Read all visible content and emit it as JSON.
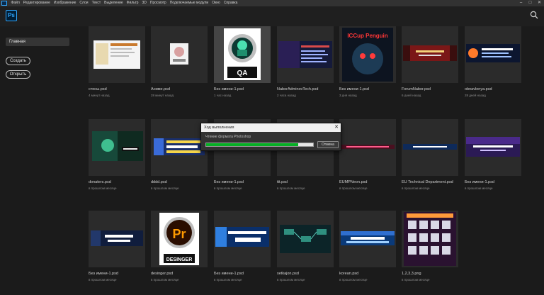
{
  "menubar": {
    "items": [
      "Файл",
      "Редактирование",
      "Изображение",
      "Слои",
      "Текст",
      "Выделение",
      "Фильтр",
      "3D",
      "Просмотр",
      "Подключаемые модули",
      "Окно",
      "Справка"
    ]
  },
  "header": {
    "logo_text": "Ps"
  },
  "sidebar": {
    "home_label": "Главная",
    "create_label": "Создать",
    "open_label": "Открыть"
  },
  "files": [
    {
      "name": "стены.psd",
      "date": "4 минут назад"
    },
    {
      "name": "Аниме.psd",
      "date": "28 минут назад"
    },
    {
      "name": "Без имени-1.psd",
      "date": "1 час назад",
      "thumb_text": "QA"
    },
    {
      "name": "NaborAdminovTech.psd",
      "date": "2 часа назад"
    },
    {
      "name": "Без имени-1.psd",
      "date": "3 дня назад",
      "thumb_text": "ICCup Penguin"
    },
    {
      "name": "ForumNabor.psd",
      "date": "6 дней назад"
    },
    {
      "name": "obnavlenya.psd",
      "date": "28 дней назад"
    },
    {
      "name": "donaters.psd",
      "date": "в прошлом месяце"
    },
    {
      "name": "dddd.psd",
      "date": "в прошлом месяце"
    },
    {
      "name": "Без имени-1.psd",
      "date": "в прошлом месяце"
    },
    {
      "name": "ttt.psd",
      "date": "в прошлом месяце"
    },
    {
      "name": "EUMPNeon.psd",
      "date": "в прошлом месяце"
    },
    {
      "name": "EU Technical Department.psd",
      "date": "в прошлом месяце"
    },
    {
      "name": "Без имени-1.psd",
      "date": "в прошлом месяце"
    },
    {
      "name": "Без имени-1.psd",
      "date": "в прошлом месяце"
    },
    {
      "name": "desinger.psd",
      "date": "в прошлом месяце",
      "thumb_text": "DESINGER"
    },
    {
      "name": "Без имени-1.psd",
      "date": "в прошлом месяце"
    },
    {
      "name": "setkajon.psd",
      "date": "в прошлом месяце"
    },
    {
      "name": "korean.psd",
      "date": "в прошлом месяце"
    },
    {
      "name": "1,2,3,3.png",
      "date": "в прошлом месяце"
    }
  ],
  "dialog": {
    "title": "Ход выполнения",
    "message": "Чтение формата Photoshop",
    "cancel_label": "Отмена",
    "progress": 0.86,
    "progress_color": "#06b025"
  },
  "colors": {
    "accent": "#31a8ff",
    "background": "#1b1b1b",
    "card": "#2b2b2b"
  }
}
